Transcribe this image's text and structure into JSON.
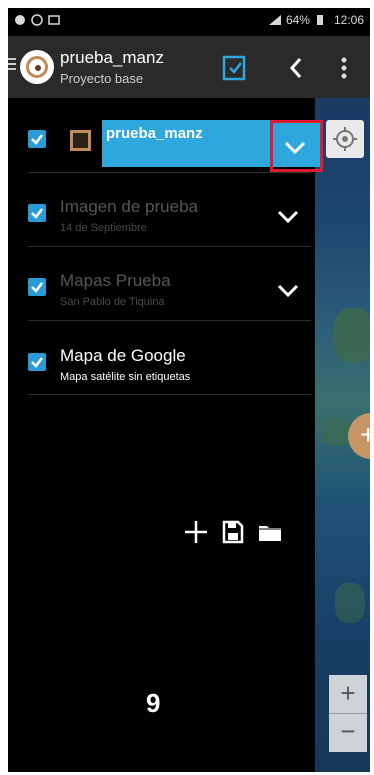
{
  "status_bar": {
    "battery": "64%",
    "time": "12:06"
  },
  "app_bar": {
    "title": "prueba_manz",
    "subtitle": "Proyecto base"
  },
  "layers": [
    {
      "name": "prueba_manz",
      "description": "",
      "checked": true,
      "active": true
    },
    {
      "name": "Imagen de prueba",
      "description": "14 de Septiembre",
      "checked": true,
      "active": false
    },
    {
      "name": "Mapas Prueba",
      "description": "San Pablo de Tiquina",
      "checked": true,
      "active": false
    },
    {
      "name": "Mapa de Google",
      "description": "Mapa satélite sin etiquetas",
      "checked": true,
      "active": false
    }
  ],
  "step_number": "9",
  "map_controls": {
    "fab_label": "+",
    "zoom_in_label": "+",
    "zoom_out_label": "−"
  },
  "colors": {
    "accent": "#2ea7dc",
    "highlight": "#e11b2f",
    "swatch": "#c58a59",
    "fab": "#c79466"
  },
  "icons": [
    "whatsapp-icon",
    "signal-icon",
    "battery-icon",
    "menu-icon",
    "app-logo-icon",
    "layers-check-icon",
    "back-chevron-icon",
    "overflow-icon",
    "locate-icon",
    "add-icon",
    "save-icon",
    "folder-icon"
  ]
}
